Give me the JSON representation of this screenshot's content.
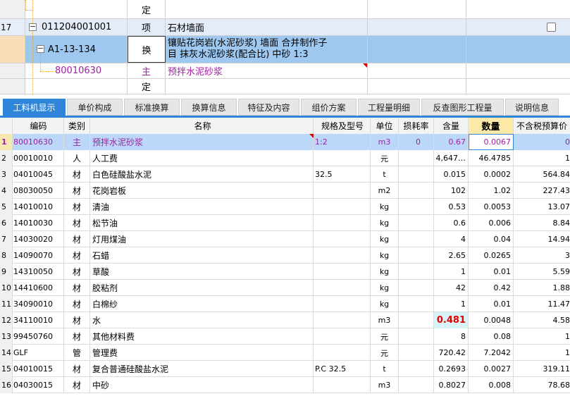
{
  "tree": {
    "rows": [
      {
        "idx": "",
        "code": "",
        "type": "定",
        "name": "",
        "kind": "plain"
      },
      {
        "idx": "17",
        "code": "011204001001",
        "type": "项",
        "name": "石材墙面",
        "kind": "item"
      },
      {
        "idx": "",
        "code": "A1-13-134",
        "type": "换",
        "name_line1": "镶贴花岗岩(水泥砂浆) 墙面  合并制作子",
        "name_line2": "目 抹灰水泥砂浆(配合比) 中砂 1:3",
        "kind": "selected"
      },
      {
        "idx": "",
        "code": "80010630",
        "type": "主",
        "name": "预拌水泥砂浆",
        "kind": "material"
      },
      {
        "idx": "",
        "code": "",
        "type": "定",
        "name": "",
        "kind": "plain"
      }
    ]
  },
  "tabs": [
    {
      "label": "工料机显示",
      "active": true
    },
    {
      "label": "单价构成",
      "active": false
    },
    {
      "label": "标准换算",
      "active": false
    },
    {
      "label": "换算信息",
      "active": false
    },
    {
      "label": "特征及内容",
      "active": false
    },
    {
      "label": "组价方案",
      "active": false
    },
    {
      "label": "工程量明细",
      "active": false
    },
    {
      "label": "反查图形工程量",
      "active": false
    },
    {
      "label": "说明信息",
      "active": false
    }
  ],
  "grid": {
    "headers": {
      "code": "编码",
      "cat": "类别",
      "name": "名称",
      "spec": "规格及型号",
      "unit": "单位",
      "loss": "损耗率",
      "content": "含量",
      "qty": "数量",
      "price": "不含税预算价"
    },
    "rows": [
      {
        "idx": "1",
        "code": "80010630",
        "cat": "主",
        "name": "预拌水泥砂浆",
        "spec": "1:2",
        "unit": "m3",
        "loss": "0",
        "content": "0.67",
        "qty": "0.0067",
        "price": "0"
      },
      {
        "idx": "2",
        "code": "00010010",
        "cat": "人",
        "name": "人工费",
        "spec": "",
        "unit": "元",
        "loss": "",
        "content": "4,647…",
        "qty": "46.4785",
        "price": "1"
      },
      {
        "idx": "3",
        "code": "04010045",
        "cat": "材",
        "name": "白色硅酸盐水泥",
        "spec": "32.5",
        "unit": "t",
        "loss": "",
        "content": "0.015",
        "qty": "0.0002",
        "price": "564.84"
      },
      {
        "idx": "4",
        "code": "08030050",
        "cat": "材",
        "name": "花岗岩板",
        "spec": "",
        "unit": "m2",
        "loss": "",
        "content": "102",
        "qty": "1.02",
        "price": "227.43"
      },
      {
        "idx": "5",
        "code": "14010010",
        "cat": "材",
        "name": "清油",
        "spec": "",
        "unit": "kg",
        "loss": "",
        "content": "0.53",
        "qty": "0.0053",
        "price": "13.07"
      },
      {
        "idx": "6",
        "code": "14010030",
        "cat": "材",
        "name": "松节油",
        "spec": "",
        "unit": "kg",
        "loss": "",
        "content": "0.6",
        "qty": "0.006",
        "price": "8.84"
      },
      {
        "idx": "7",
        "code": "14030020",
        "cat": "材",
        "name": "灯用煤油",
        "spec": "",
        "unit": "kg",
        "loss": "",
        "content": "4",
        "qty": "0.04",
        "price": "14.94"
      },
      {
        "idx": "8",
        "code": "14090070",
        "cat": "材",
        "name": "石蜡",
        "spec": "",
        "unit": "kg",
        "loss": "",
        "content": "2.65",
        "qty": "0.0265",
        "price": "3"
      },
      {
        "idx": "9",
        "code": "14310050",
        "cat": "材",
        "name": "草酸",
        "spec": "",
        "unit": "kg",
        "loss": "",
        "content": "1",
        "qty": "0.01",
        "price": "5.59"
      },
      {
        "idx": "10",
        "code": "14410600",
        "cat": "材",
        "name": "胶粘剂",
        "spec": "",
        "unit": "kg",
        "loss": "",
        "content": "42",
        "qty": "0.42",
        "price": "1.88"
      },
      {
        "idx": "11",
        "code": "34090010",
        "cat": "材",
        "name": "白棉纱",
        "spec": "",
        "unit": "kg",
        "loss": "",
        "content": "1",
        "qty": "0.01",
        "price": "11.47"
      },
      {
        "idx": "12",
        "code": "34110010",
        "cat": "材",
        "name": "水",
        "spec": "",
        "unit": "m3",
        "loss": "",
        "content": "0.481",
        "qty": "0.0048",
        "price": "4.58"
      },
      {
        "idx": "13",
        "code": "99450760",
        "cat": "材",
        "name": "其他材料费",
        "spec": "",
        "unit": "元",
        "loss": "",
        "content": "8",
        "qty": "0.08",
        "price": "1"
      },
      {
        "idx": "14",
        "code": "GLF",
        "cat": "管",
        "name": "管理费",
        "spec": "",
        "unit": "元",
        "loss": "",
        "content": "720.42",
        "qty": "7.2042",
        "price": "1"
      },
      {
        "idx": "15",
        "code": "04010015",
        "cat": "材",
        "name": "复合普通硅酸盐水泥",
        "spec": "P.C 32.5",
        "unit": "t",
        "loss": "",
        "content": "0.2693",
        "qty": "0.0027",
        "price": "319.11"
      },
      {
        "idx": "16",
        "code": "04030015",
        "cat": "材",
        "name": "中砂",
        "spec": "",
        "unit": "m3",
        "loss": "",
        "content": "0.8027",
        "qty": "0.008",
        "price": "78.68"
      }
    ]
  }
}
